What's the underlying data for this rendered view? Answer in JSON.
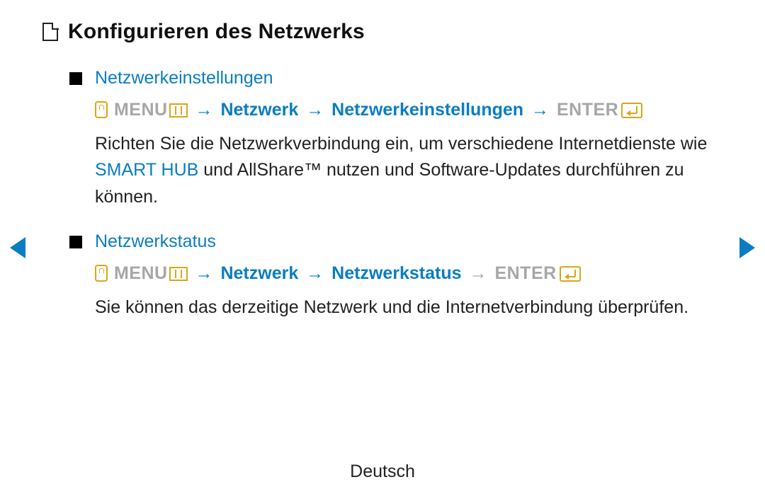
{
  "page_title": "Konfigurieren des Netzwerks",
  "menu_label": "MENU",
  "enter_label": "ENTER",
  "arrow": "→",
  "sections": [
    {
      "title": "Netzwerkeinstellungen",
      "path1": "Netzwerk",
      "path2": "Netzwerkeinstellungen",
      "body_pre": "Richten Sie die Netzwerkverbindung ein, um verschiedene Internetdienste wie ",
      "smart_hub": "SMART HUB",
      "body_post": " und AllShare™ nutzen und Software-Updates durchführen zu können."
    },
    {
      "title": "Netzwerkstatus",
      "path1": "Netzwerk",
      "path2": "Netzwerkstatus",
      "body": "Sie können das derzeitige Netzwerk und die Internetverbindung überprüfen."
    }
  ],
  "footer_language": "Deutsch"
}
